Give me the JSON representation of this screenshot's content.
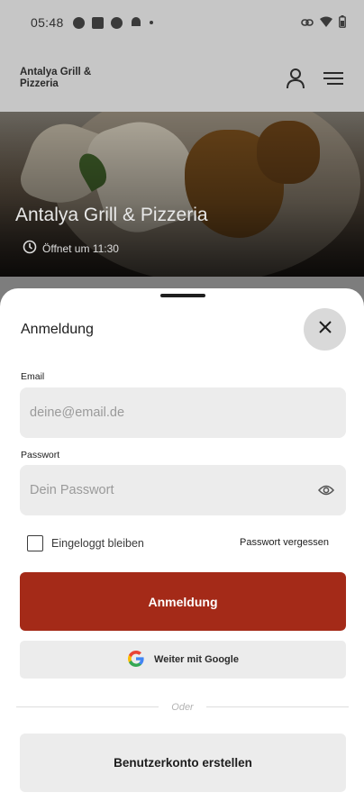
{
  "status_bar": {
    "time": "05:48",
    "icons_left": [
      "sync-icon",
      "square-icon",
      "settings-icon",
      "android-icon",
      "dot-icon"
    ],
    "icons_right": [
      "link-icon",
      "wifi-icon",
      "battery-icon"
    ]
  },
  "header": {
    "brand": "Antalya Grill & Pizzeria",
    "icons": [
      "account-icon",
      "menu-icon"
    ]
  },
  "hero": {
    "title": "Antalya Grill & Pizzeria",
    "open_text": "Öffnet um 11:30"
  },
  "login_sheet": {
    "title": "Anmeldung",
    "email": {
      "label": "Email",
      "value": "",
      "placeholder": "deine@email.de"
    },
    "password": {
      "label": "Passwort",
      "value": "",
      "placeholder": "Dein Passwort"
    },
    "remember_label": "Eingeloggt bleiben",
    "remember_checked": false,
    "forgot_label": "Passwort vergessen",
    "submit_label": "Anmeldung",
    "google_label": "Weiter mit Google",
    "divider_label": "Oder",
    "create_account_label": "Benutzerkonto erstellen"
  },
  "colors": {
    "primary": "#a42a18",
    "field_bg": "#ececec",
    "overlay": "#7d7d7d"
  }
}
